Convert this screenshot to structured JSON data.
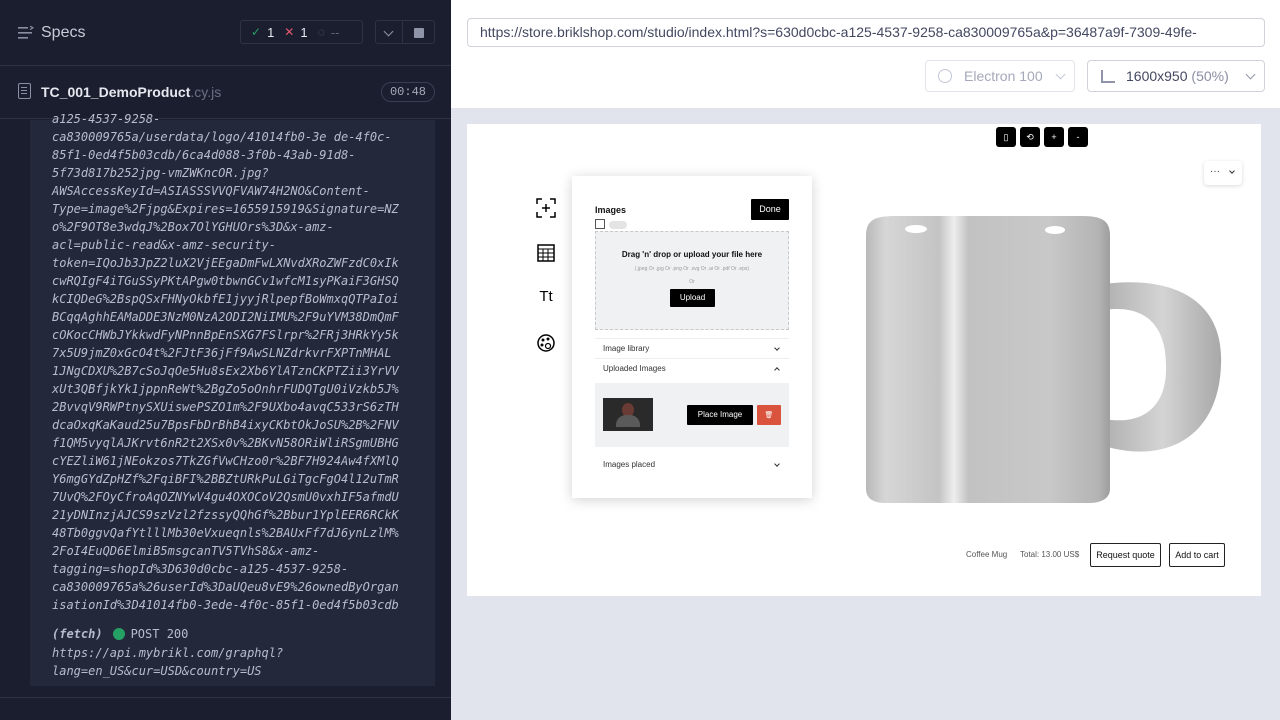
{
  "runner": {
    "title": "Specs",
    "stats": {
      "passed": "1",
      "failed": "1",
      "pending": "--"
    },
    "spec": {
      "name": "TC_001_DemoProduct",
      "ext": ".cy.js",
      "duration": "00:48"
    },
    "log_url": "a125-4537-9258-\nca830009765a/userdata/logo/41014fb0-3e de-4f0c-\n85f1-0ed4f5b03cdb/6ca4d088-3f0b-43ab-91d8-\n5f73d817b252jpg-vmZWKncOR.jpg?\nAWSAccessKeyId=ASIASSSVVQFVAW74H2NO&Content-\nType=image%2Fjpg&Expires=1655915919&Signature=NZ\no%2F9OT8e3wdqJ%2Box7OlYGHUOrs%3D&x-amz-\nacl=public-read&x-amz-security-\ntoken=IQoJb3JpZ2luX2VjEEgaDmFwLXNvdXRoZWFzdC0xIk\ncwRQIgF4iTGuSSyPKtAPgw0tbwnGCv1wfcM1syPKaiF3GHSQ\nkCIQDeG%2BspQSxFHNyOkbfE1jyyjRlpepfBoWmxqQTPaIoi\nBCqqAghhEAMaDDE3NzM0NzA2ODI2NiIMU%2F9uYVM38DmQmF\ncOKocCHWbJYkkwdFyNPnnBpEnSXG7FSlrpr%2FRj3HRkYy5k\n7x5U9jmZ0xGcO4t%2FJtF36jFf9AwSLNZdrkvrFXPTnMHAL\n1JNgCDXU%2B7cSoJqOe5Hu8sEx2Xb6YlATznCKPTZii3YrVV\nxUt3QBfjkYk1jppnReWt%2BgZo5oOnhrFUDQTgU0iVzkb5J%\n2BvvqV9RWPtnySXUiswePSZO1m%2F9UXbo4avqC533rS6zTH\ndcaOxqKaKaud25u7BpsFbDrBhB4ixyCKbtOkJoSU%2B%2FNV\nf1QM5vyqlAJKrvt6nR2t2XSx0v%2BKvN58ORiWliRSgmUBHG\ncYEZliW61jNEokzos7TkZGfVwCHzo0r%2BF7H924Aw4fXMlQ\nY6mgGYdZpHZf%2FqiBFI%2BBZtURkPuLGiTgcFgO4l12uTmR\n7UvQ%2FOyCfroAqOZNYwV4gu4OXOCoV2QsmU0vxhIF5afmdU\n21yDNInzjAJCS9szVzl2fzssyQQhGf%2Bbur1YplEER6RCkK\n48Tb0ggvQafYtlllMb30eVxueqnls%2BAUxFf7dJ6ynLzlM%\n2FoI4EuQD6ElmiB5msgcanTV5TVhS8&x-amz-\ntagging=shopId%3D630d0cbc-a125-4537-9258-\nca830009765a%26userId%3DaUQeu8vE9%26ownedByOrgan\nisationId%3D41014fb0-3ede-4f0c-85f1-0ed4f5b03cdb",
    "fetch": {
      "label": "(fetch)",
      "method": "POST 200",
      "url": "https://api.mybrikl.com/graphql?\nlang=en_US&cur=USD&country=US"
    }
  },
  "browser": {
    "url": "https://store.briklshop.com/studio/index.html?s=630d0cbc-a125-4537-9258-ca830009765a&p=36487a9f-7309-49fe-",
    "name": "Electron 100",
    "viewport": "1600x950",
    "viewport_pct": "(50%)"
  },
  "studio": {
    "mini_toolbar": [
      "▯",
      "⟲",
      "+",
      "-"
    ],
    "more": "···",
    "panel": {
      "title": "Images",
      "done": "Done",
      "drop_title": "Drag 'n' drop or upload your file here",
      "drop_types": "(.jpeg Or .jpg Or .png Or .svg Or .ai Or .pdf Or .eps)",
      "drop_or": "Or",
      "upload": "Upload",
      "image_library": "Image library",
      "uploaded_images": "Uploaded Images",
      "place_image": "Place Image",
      "images_placed": "Images placed",
      "delete": "🗑"
    },
    "product_name": "Coffee Mug",
    "total": "Total: 13.00 US$",
    "request_quote": "Request quote",
    "add_to_cart": "Add to cart"
  }
}
